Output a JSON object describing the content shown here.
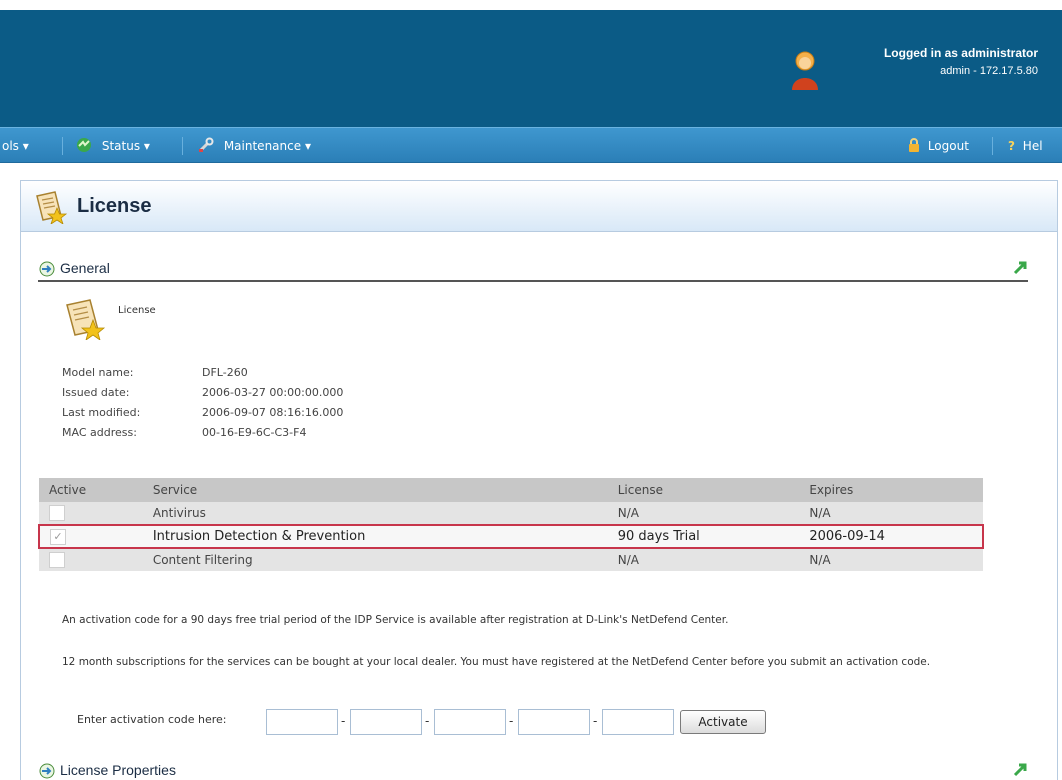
{
  "header": {
    "user_line1": "Logged in as administrator",
    "user_line2": "admin - 172.17.5.80",
    "color": "#0b5b86"
  },
  "menubar": {
    "tools_label": "ols",
    "status_label": "Status",
    "maintenance_label": "Maintenance",
    "logout_label": "Logout",
    "help_label": "Hel"
  },
  "page": {
    "title": "License"
  },
  "general": {
    "section_title": "General",
    "icon_label": "License",
    "fields": [
      {
        "label": "Model name:",
        "value": "DFL-260"
      },
      {
        "label": "Issued date:",
        "value": "2006-03-27 00:00:00.000"
      },
      {
        "label": "Last modified:",
        "value": "2006-09-07 08:16:16.000"
      },
      {
        "label": "MAC address:",
        "value": "00-16-E9-6C-C3-F4"
      }
    ]
  },
  "services": {
    "headers": [
      "Active",
      "Service",
      "License",
      "Expires"
    ],
    "rows": [
      {
        "active": false,
        "service": "Antivirus",
        "license": "N/A",
        "expires": "N/A"
      },
      {
        "active": true,
        "service": "Intrusion Detection & Prevention",
        "license": "90 days Trial",
        "expires": "2006-09-14"
      },
      {
        "active": false,
        "service": "Content Filtering",
        "license": "N/A",
        "expires": "N/A"
      }
    ],
    "highlight_color": "#c7354b"
  },
  "notes": {
    "p1": "An activation code for a 90 days free trial period of the IDP Service is available after registration at D-Link's NetDefend Center.",
    "p2": "12 month subscriptions for the services can be bought at your local dealer. You must have registered at the NetDefend Center before you submit an activation code."
  },
  "activation": {
    "label": "Enter activation code here:",
    "separator": "-",
    "button_label": "Activate"
  },
  "license_properties": {
    "section_title": "License Properties"
  }
}
